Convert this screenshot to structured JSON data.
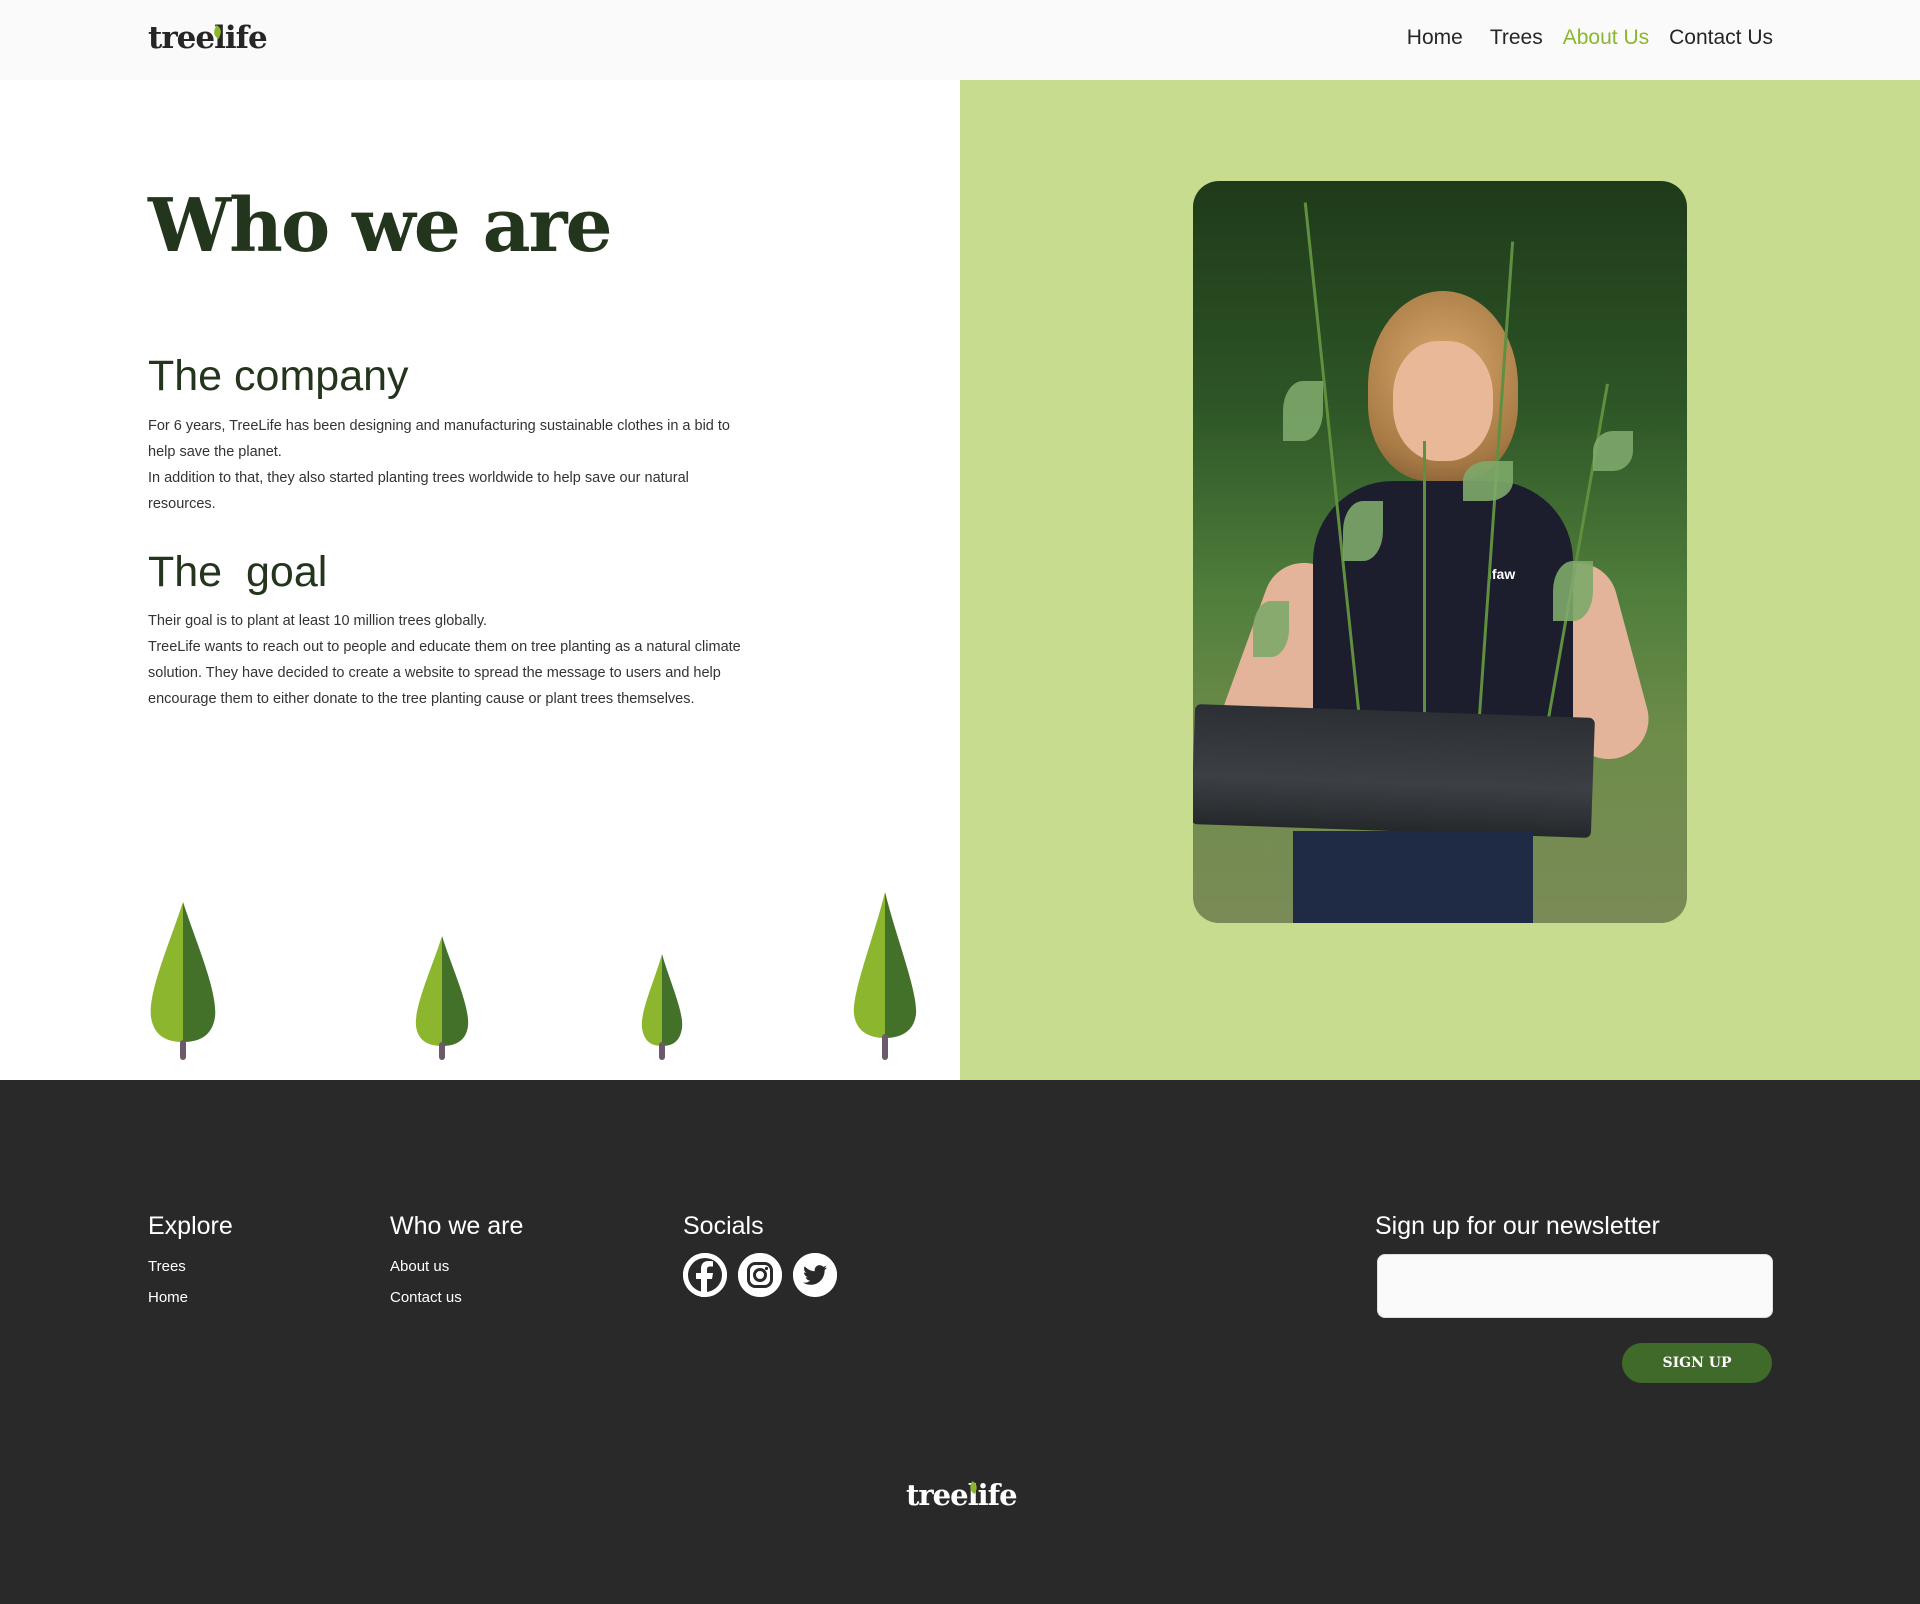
{
  "header": {
    "logo": "treelife",
    "nav": [
      "Home",
      "Trees",
      "About Us",
      "Contact Us"
    ],
    "active_nav": "About Us"
  },
  "hero": {
    "title": "Who we are",
    "company_heading": "The company",
    "company_text": [
      "For 6 years, TreeLife has been designing and manufacturing sustainable clothes in a bid to help save the planet.",
      "In addition to that, they also started planting trees worldwide to help save our natural resources."
    ],
    "goal_heading": "The  goal",
    "goal_text": [
      "Their goal is to plant at least 10 million trees globally.",
      "TreeLife wants to reach out to people and educate them on tree planting as a natural climate solution. They have decided to create a website to spread the message to users and help encourage them to either donate to the tree planting cause or plant trees themselves."
    ],
    "photo_shirt_text": "ifaw"
  },
  "footer": {
    "explore": {
      "title": "Explore",
      "links": [
        "Trees",
        "Home"
      ]
    },
    "who": {
      "title": "Who we are",
      "links": [
        "About us",
        "Contact us"
      ]
    },
    "socials": {
      "title": "Socials",
      "icons": [
        "facebook-icon",
        "instagram-icon",
        "twitter-icon"
      ]
    },
    "newsletter": {
      "title": "Sign up for our newsletter",
      "input_value": "",
      "button": "SIGN UP"
    },
    "logo": "treelife"
  },
  "colors": {
    "accent": "#8bb62d",
    "dark_green": "#23351c",
    "panel_green": "#c8dc8f",
    "footer_bg": "#292929",
    "button_green": "#3f6a2a"
  }
}
